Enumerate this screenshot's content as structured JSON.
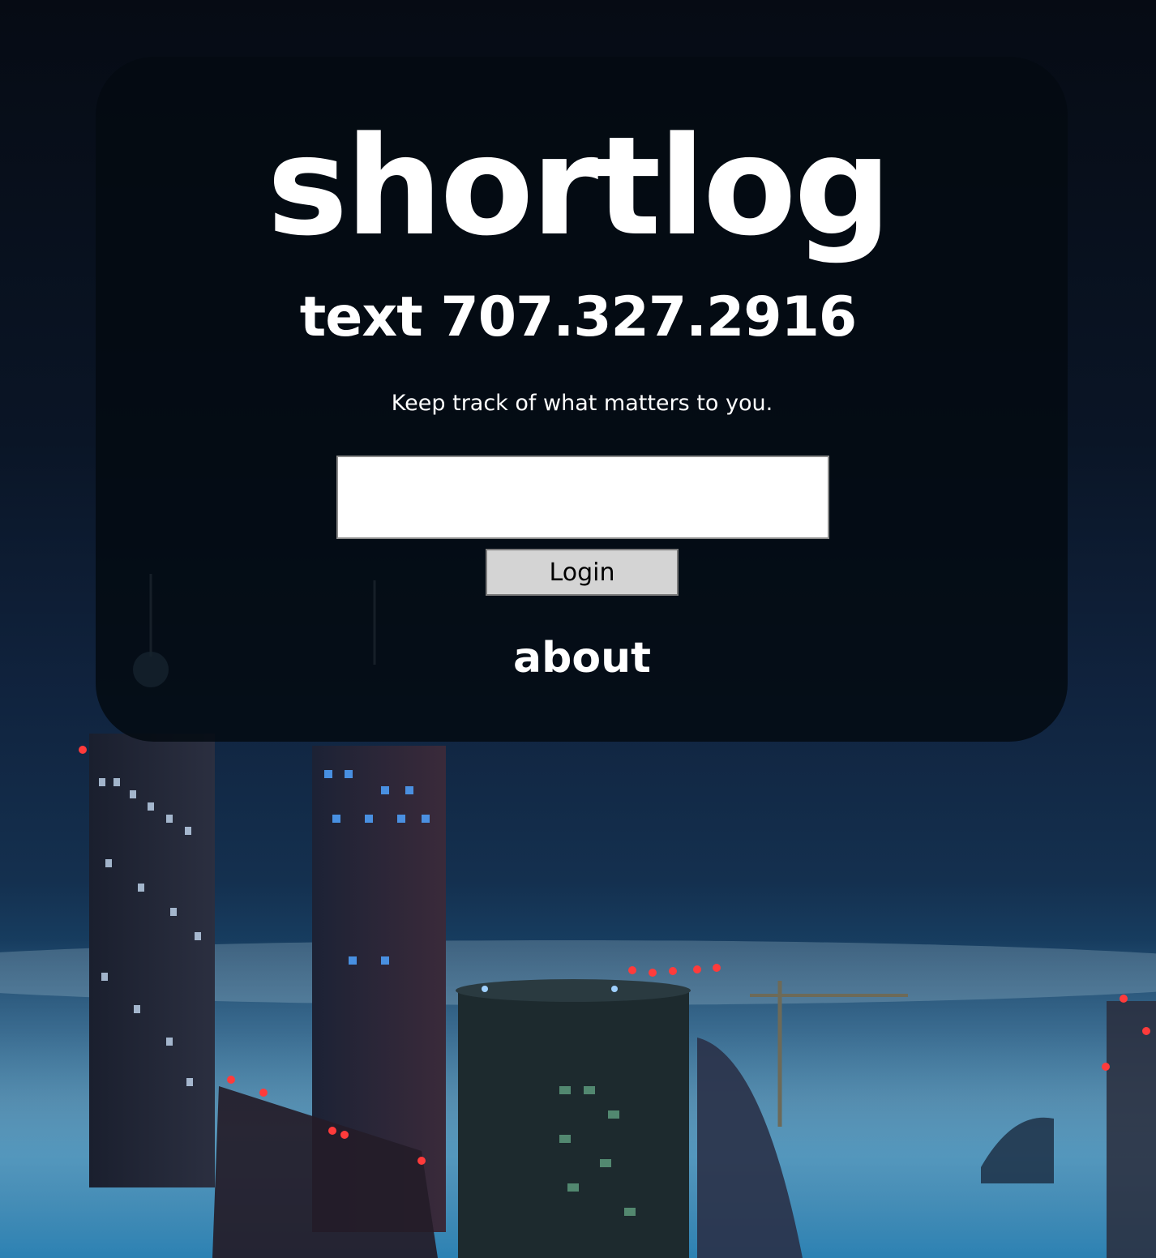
{
  "header": {
    "brand": "shortlog",
    "phone_line": "text 707.327.2916",
    "tagline": "Keep track of what matters to you."
  },
  "login": {
    "input_value": "",
    "input_placeholder": "",
    "button_label": "Login"
  },
  "footer": {
    "about_label": "about"
  },
  "colors": {
    "card_bg": "#040a12",
    "text": "#ffffff",
    "button_bg": "#d4d4d4",
    "city_light_red": "#ff3b3b",
    "city_light_blue": "#4fa3ff"
  }
}
